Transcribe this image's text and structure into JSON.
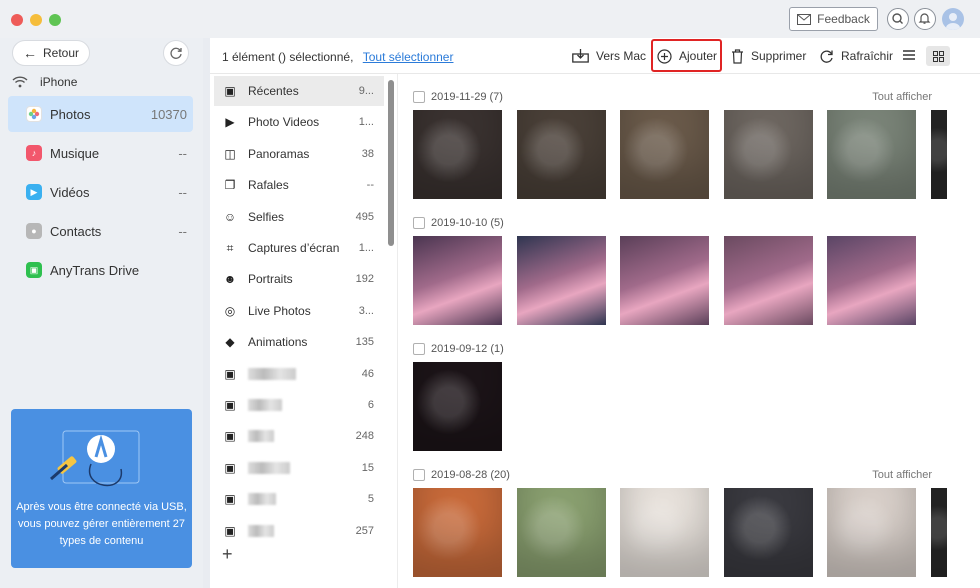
{
  "header": {
    "feedback_label": "Feedback",
    "icons": [
      "mail-icon",
      "search-icon",
      "bell-icon",
      "avatar"
    ]
  },
  "sidebar": {
    "back_label": "Retour",
    "device_name": "iPhone",
    "items": [
      {
        "label": "Photos",
        "count": "10370",
        "color": "#f2a33a"
      },
      {
        "label": "Musique",
        "count": "--",
        "color": "#f2576c"
      },
      {
        "label": "Vidéos",
        "count": "--",
        "color": "#3ab0f0"
      },
      {
        "label": "Contacts",
        "count": "--",
        "color": "#b7b7b7"
      },
      {
        "label": "AnyTrans Drive",
        "count": "",
        "color": "#2ec04f"
      }
    ],
    "promo_text": "Après vous être connecté via USB, vous pouvez gérer entièrement 27 types de contenu"
  },
  "toolbar": {
    "selection_text": "1 élément () sélectionné,",
    "select_all": "Tout sélectionner",
    "to_mac": "Vers Mac",
    "add": "Ajouter",
    "delete": "Supprimer",
    "refresh": "Rafraîchir"
  },
  "albums": [
    {
      "name": "Récentes",
      "count": "9...",
      "icon": "album-icon"
    },
    {
      "name": "Photo Videos",
      "count": "1...",
      "icon": "video-icon"
    },
    {
      "name": "Panoramas",
      "count": "38",
      "icon": "panorama-icon"
    },
    {
      "name": "Rafales",
      "count": "--",
      "icon": "burst-icon"
    },
    {
      "name": "Selfies",
      "count": "495",
      "icon": "selfie-icon"
    },
    {
      "name": "Captures d’écran",
      "count": "1...",
      "icon": "screenshot-icon"
    },
    {
      "name": "Portraits",
      "count": "192",
      "icon": "portrait-icon"
    },
    {
      "name": "Live Photos",
      "count": "3...",
      "icon": "live-photo-icon"
    },
    {
      "name": "Animations",
      "count": "135",
      "icon": "animation-icon"
    },
    {
      "name": "",
      "count": "46",
      "icon": "album-icon"
    },
    {
      "name": "",
      "count": "6",
      "icon": "album-icon"
    },
    {
      "name": "",
      "count": "248",
      "icon": "album-icon"
    },
    {
      "name": "",
      "count": "15",
      "icon": "album-icon"
    },
    {
      "name": "",
      "count": "5",
      "icon": "album-icon"
    },
    {
      "name": "",
      "count": "257",
      "icon": "album-icon"
    }
  ],
  "photo_groups": [
    {
      "date": "2019-11-29 (7)",
      "show_all": "Tout afficher",
      "thumbs": [
        "#3a3230",
        "#4a4038",
        "#6a5a4a",
        "#6d6660",
        "#7a8478",
        "#2a2a2a"
      ]
    },
    {
      "date": "2019-10-10 (5)",
      "show_all": "",
      "thumbs": [
        "#4a3550",
        "#2f3550",
        "#5a3f58",
        "#6a4a60",
        "#5a4565"
      ]
    },
    {
      "date": "2019-09-12 (1)",
      "show_all": "",
      "thumbs": [
        "#1c1418"
      ]
    },
    {
      "date": "2019-08-28 (20)",
      "show_all": "Tout afficher",
      "thumbs": [
        "#c86a3a",
        "#8aa070",
        "#e8e2dc",
        "#3a3a40",
        "#d9d0ca",
        "#2a2a2a"
      ]
    }
  ]
}
